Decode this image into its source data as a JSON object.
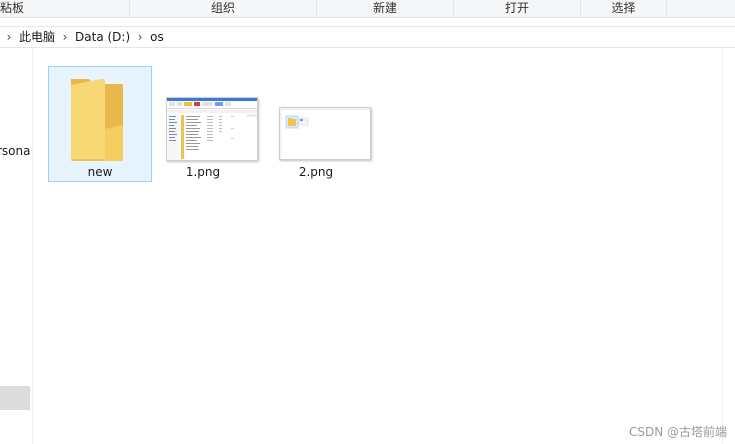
{
  "ribbon": {
    "groups": [
      "粘板",
      "组织",
      "新建",
      "打开",
      "选择",
      ""
    ]
  },
  "address": {
    "crumbs": [
      "此电脑",
      "Data (D:)",
      "os"
    ]
  },
  "nav": {
    "partial_item": "rsona"
  },
  "files": [
    {
      "name": "new",
      "type": "folder"
    },
    {
      "name": "1.png",
      "type": "image"
    },
    {
      "name": "2.png",
      "type": "image"
    }
  ],
  "watermark": "CSDN @古塔前端",
  "colors": {
    "folder_body": "#f8d775",
    "folder_back": "#e8b84a",
    "selection_border": "#99d1ff",
    "selection_fill": "#e8f4fd"
  }
}
